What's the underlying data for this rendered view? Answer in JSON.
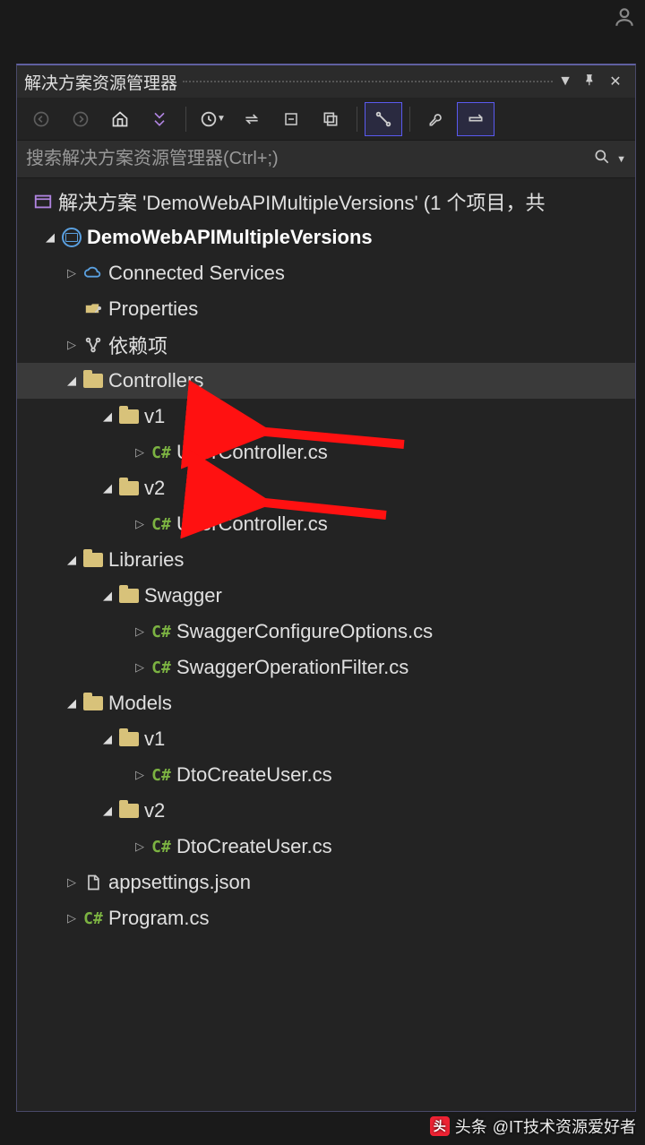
{
  "panel": {
    "title": "解决方案资源管理器",
    "search_placeholder": "搜索解决方案资源管理器(Ctrl+;)"
  },
  "tree": {
    "solution": "解决方案 'DemoWebAPIMultipleVersions' (1 个项目，共",
    "project": "DemoWebAPIMultipleVersions",
    "connected": "Connected Services",
    "properties": "Properties",
    "deps": "依赖项",
    "controllers": "Controllers",
    "v1": "v1",
    "usercontroller": "UserController.cs",
    "v2": "v2",
    "libraries": "Libraries",
    "swagger": "Swagger",
    "swaggerconfig": "SwaggerConfigureOptions.cs",
    "swaggerfilter": "SwaggerOperationFilter.cs",
    "models": "Models",
    "dtocreateuser": "DtoCreateUser.cs",
    "appsettings": "appsettings.json",
    "program": "Program.cs"
  },
  "watermark": "@IT技术资源爱好者",
  "watermark_prefix": "头条"
}
